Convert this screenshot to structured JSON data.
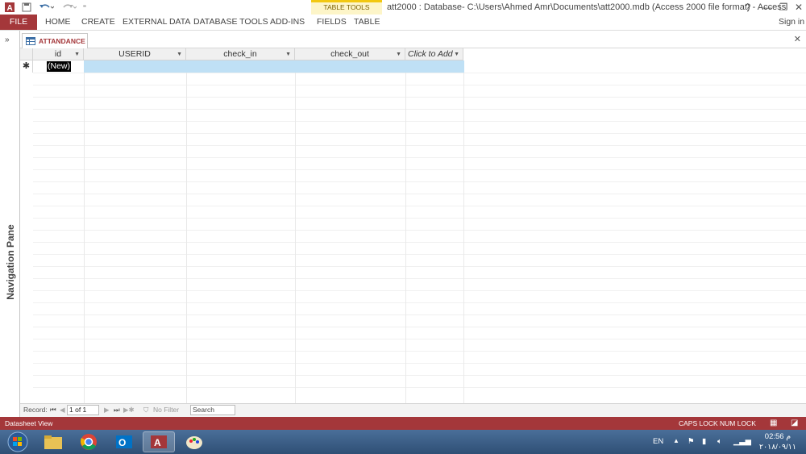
{
  "titlebar": {
    "title": "att2000 : Database- C:\\Users\\Ahmed Amr\\Documents\\att2000.mdb (Access 2000 file format) - Access",
    "help": "?",
    "sign_in": "Sign in"
  },
  "ribbon": {
    "file": "FILE",
    "tabs": [
      "HOME",
      "CREATE",
      "EXTERNAL DATA",
      "DATABASE TOOLS",
      "ADD-INS"
    ],
    "context_group": "TABLE TOOLS",
    "context_tabs": [
      "FIELDS",
      "TABLE"
    ]
  },
  "document_tab": {
    "label": "ATTANDANCE"
  },
  "navigation_pane": {
    "label": "Navigation Pane",
    "toggle": "»"
  },
  "datasheet": {
    "columns": [
      "id",
      "USERID",
      "check_in",
      "check_out",
      "Click to Add"
    ],
    "new_row_marker": "✱",
    "new_row_value": "(New)"
  },
  "record_nav": {
    "label": "Record:",
    "current": "1 of 1",
    "filter": "No Filter",
    "search_placeholder": "Search"
  },
  "statusbar": {
    "view": "Datasheet View",
    "caps": "CAPS LOCK",
    "num": "NUM LOCK"
  },
  "taskbar": {
    "lang": "EN",
    "time": "02:56 م",
    "date": "٢٠١٨/٠٩/١١"
  },
  "colors": {
    "access_red": "#a4373a",
    "context_yellow": "#f2c811",
    "new_row_highlight": "#bfe0f5"
  }
}
